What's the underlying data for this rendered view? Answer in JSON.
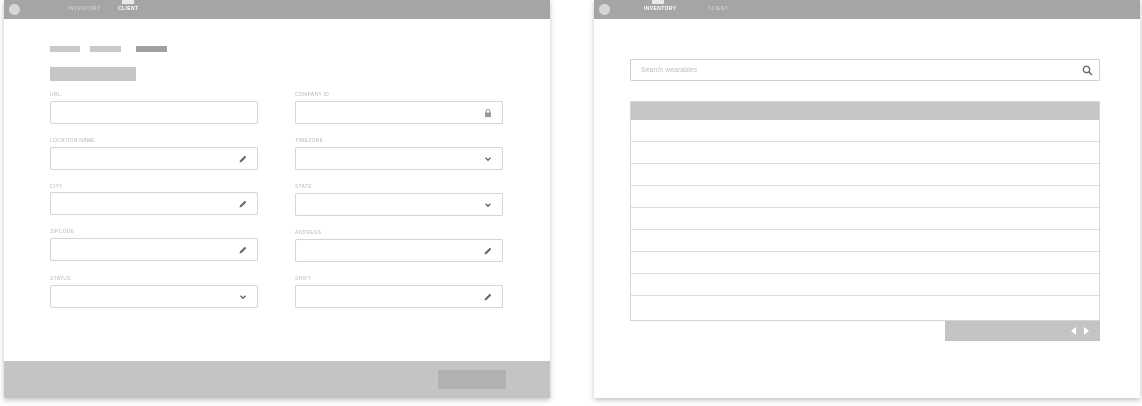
{
  "left": {
    "nav": {
      "inventory": "INVENTORY",
      "client": "CLIENT"
    },
    "form": {
      "url_label": "URL",
      "company_id_label": "COMPANY ID",
      "location_name_label": "LOCATION NAME",
      "timezone_label": "TIMEZONE",
      "city_label": "CITY",
      "state_label": "STATE",
      "zipcode_label": "ZIPCODE",
      "address_label": "ADDRESS",
      "status_label": "STATUS",
      "shift_label": "SHIFT"
    }
  },
  "right": {
    "nav": {
      "inventory": "INVENTORY",
      "client": "CLIENT"
    },
    "search": {
      "placeholder": "Search wearables"
    }
  },
  "icons": {
    "edit": "pencil-icon",
    "lock": "lock-icon",
    "dropdown": "chevron-down-icon",
    "search": "search-icon",
    "prev": "triangle-left-icon",
    "next": "triangle-right-icon"
  },
  "colors": {
    "topbar": "#a5a5a5",
    "footer": "#c4c4c4",
    "table_header": "#c6c6c6",
    "field_border": "#d5d5d5"
  }
}
